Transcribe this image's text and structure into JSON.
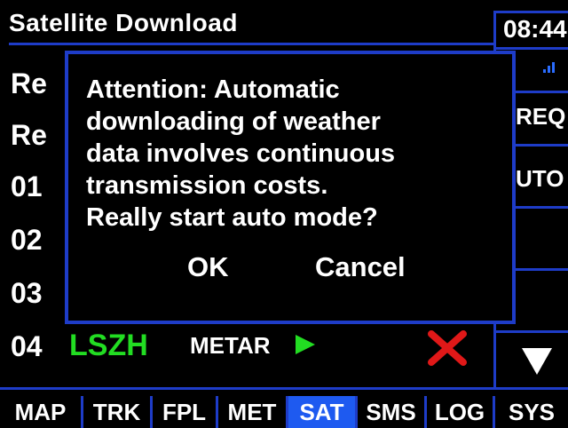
{
  "header": {
    "title": "Satellite Download",
    "clock": "08:44"
  },
  "right_panel": {
    "items": [
      "REQ",
      "UTO"
    ],
    "down_arrow_icon": "chevron-down-icon"
  },
  "list": {
    "rows": [
      {
        "label": "Re"
      },
      {
        "label": "Re"
      },
      {
        "label": "01"
      },
      {
        "label": "02"
      },
      {
        "label": "03"
      },
      {
        "label": "04",
        "station": "LSZH",
        "type": "METAR"
      }
    ]
  },
  "dialog": {
    "message_lines": [
      "Attention: Automatic",
      "downloading of weather",
      "data involves continuous",
      "transmission costs.",
      "Really start auto mode?"
    ],
    "ok_label": "OK",
    "cancel_label": "Cancel"
  },
  "tabs": [
    {
      "label": "MAP",
      "active": false
    },
    {
      "label": "TRK",
      "active": false
    },
    {
      "label": "FPL",
      "active": false
    },
    {
      "label": "MET",
      "active": false
    },
    {
      "label": "SAT",
      "active": true
    },
    {
      "label": "SMS",
      "active": false
    },
    {
      "label": "LOG",
      "active": false
    },
    {
      "label": "SYS",
      "active": false
    }
  ],
  "colors": {
    "accent_blue": "#1e3cc8",
    "active_tab": "#1e5af0",
    "station_green": "#22dd22",
    "delete_red": "#e01818"
  }
}
